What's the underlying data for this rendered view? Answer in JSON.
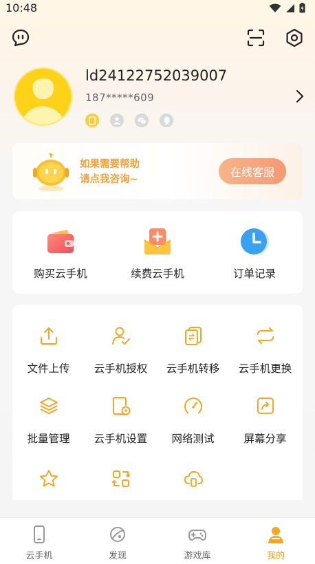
{
  "status_bar": {
    "time": "10:48"
  },
  "profile": {
    "user_id": "ld24122752039007",
    "phone": "187*****609"
  },
  "help": {
    "line1": "如果需要帮助",
    "line2": "请点我咨询~",
    "button": "在线客服"
  },
  "orders": [
    {
      "label": "购买云手机",
      "icon": "wallet-icon"
    },
    {
      "label": "续费云手机",
      "icon": "renew-icon"
    },
    {
      "label": "订单记录",
      "icon": "clock-icon"
    }
  ],
  "tools": [
    {
      "label": "文件上传",
      "icon": "upload-icon"
    },
    {
      "label": "云手机授权",
      "icon": "authorize-icon"
    },
    {
      "label": "云手机转移",
      "icon": "transfer-icon"
    },
    {
      "label": "云手机更换",
      "icon": "replace-icon"
    },
    {
      "label": "批量管理",
      "icon": "layers-icon"
    },
    {
      "label": "云手机设置",
      "icon": "settings-icon"
    },
    {
      "label": "网络测试",
      "icon": "speedometer-icon"
    },
    {
      "label": "屏幕分享",
      "icon": "share-icon"
    },
    {
      "label": "",
      "icon": "star-icon"
    },
    {
      "label": "",
      "icon": "switch-icon"
    },
    {
      "label": "",
      "icon": "cloud-phone-icon"
    }
  ],
  "tabbar": [
    {
      "label": "云手机",
      "icon": "phone-icon",
      "active": false
    },
    {
      "label": "发现",
      "icon": "planet-icon",
      "active": false
    },
    {
      "label": "游戏库",
      "icon": "gamepad-icon",
      "active": false
    },
    {
      "label": "我的",
      "icon": "profile-icon",
      "active": true
    }
  ],
  "colors": {
    "accent": "#f5a623",
    "button_gradient": "#f39a75"
  }
}
